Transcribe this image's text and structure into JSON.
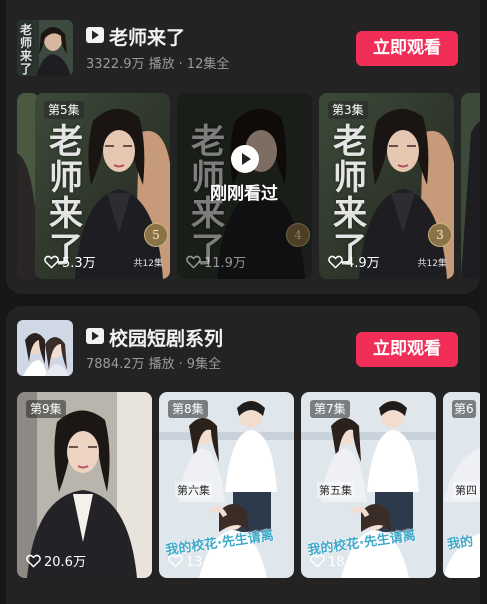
{
  "series": [
    {
      "title": "老师来了",
      "plays": "3322.9万",
      "plays_label": "播放",
      "episodes_count": "12集全",
      "cover_text": "老师来了",
      "watch_label": "立即观看",
      "episodes": [
        {
          "ep_label": "",
          "likes": "",
          "badge": "",
          "total": ""
        },
        {
          "ep_label": "第5集",
          "likes": "5.3万",
          "badge": "5",
          "total": "共12集",
          "title_chars": [
            "老",
            "师",
            "来",
            "了"
          ]
        },
        {
          "ep_label": "",
          "likes": "11.9万",
          "badge": "4",
          "total": "",
          "recent_label": "刚刚看过",
          "title_chars": [
            "老",
            "师",
            "来",
            "了"
          ]
        },
        {
          "ep_label": "第3集",
          "likes": "4.9万",
          "badge": "3",
          "total": "共12集",
          "title_chars": [
            "老",
            "师",
            "来",
            "了"
          ]
        },
        {
          "ep_label": "",
          "likes": "",
          "badge": "",
          "total": ""
        }
      ]
    },
    {
      "title": "校园短剧系列",
      "plays": "7884.2万",
      "plays_label": "播放",
      "episodes_count": "9集全",
      "watch_label": "立即观看",
      "episodes": [
        {
          "ep_label": "第9集",
          "likes": "20.6万"
        },
        {
          "ep_label": "第8集",
          "likes": "13.4万",
          "small_title": "第六集",
          "romance": "我的校花·先生请离"
        },
        {
          "ep_label": "第7集",
          "likes": "18.5万",
          "small_title": "第五集",
          "romance": "我的校花·先生请离"
        },
        {
          "ep_label": "第6",
          "likes": "",
          "small_title": "第四",
          "romance": "我的"
        }
      ]
    }
  ],
  "colors": {
    "accent": "#f12e57",
    "card_bg": "#232323",
    "page_bg": "#161616",
    "meta_text": "#9a9a9a"
  },
  "icons": {
    "series_logo": "play-logo-icon",
    "likes": "heart-icon",
    "play": "play-icon"
  }
}
